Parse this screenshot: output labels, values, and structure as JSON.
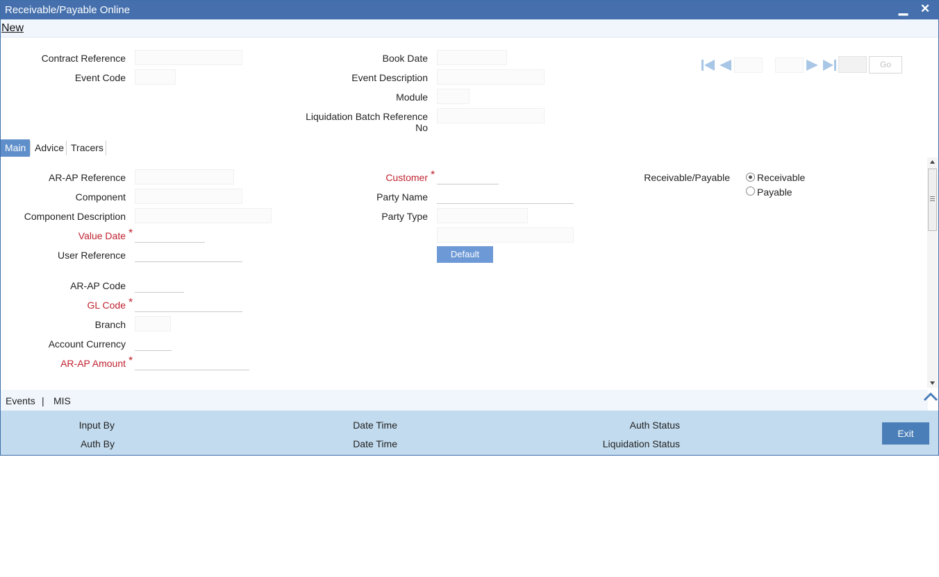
{
  "window": {
    "title": "Receivable/Payable Online",
    "minimize": "▁",
    "close": "✕"
  },
  "menu": {
    "new": "New"
  },
  "header": {
    "contract_reference": "Contract Reference",
    "event_code": "Event Code",
    "book_date": "Book Date",
    "event_description": "Event Description",
    "module": "Module",
    "liquidation_batch_reference_1": "Liquidation Batch Reference",
    "liquidation_batch_reference_2": "No"
  },
  "nav": {
    "go": "Go"
  },
  "tabs": [
    "Main",
    "Advice",
    "Tracers"
  ],
  "main": {
    "arap_reference": "AR-AP Reference",
    "component": "Component",
    "component_description": "Component Description",
    "value_date": "Value Date",
    "user_reference": "User Reference",
    "arap_code": "AR-AP Code",
    "gl_code": "GL Code",
    "branch": "Branch",
    "account_currency": "Account Currency",
    "arap_amount": "AR-AP Amount",
    "customer": "Customer",
    "party_name": "Party Name",
    "party_type": "Party Type",
    "default_button": "Default",
    "receivable_payable": "Receivable/Payable",
    "receivable": "Receivable",
    "payable": "Payable",
    "required_mark": "*"
  },
  "bottom_links": {
    "events": "Events",
    "separator": "|",
    "mis": "MIS"
  },
  "footer": {
    "input_by": "Input By",
    "auth_by": "Auth By",
    "date_time_1": "Date Time",
    "date_time_2": "Date Time",
    "auth_status": "Auth Status",
    "liquidation_status": "Liquidation Status",
    "exit": "Exit"
  }
}
